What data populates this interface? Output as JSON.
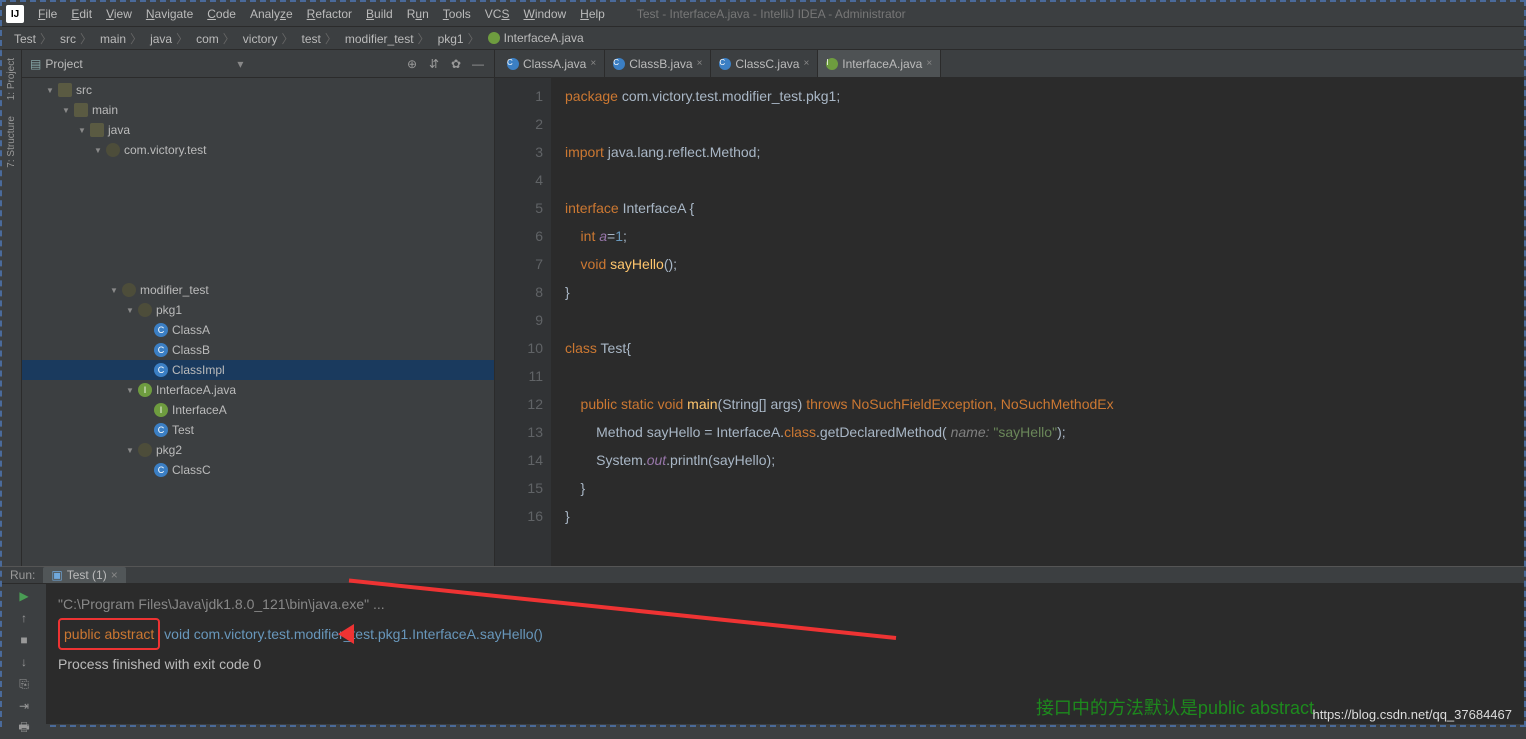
{
  "window_title": "Test - InterfaceA.java - IntelliJ IDEA - Administrator",
  "menus": [
    "File",
    "Edit",
    "View",
    "Navigate",
    "Code",
    "Analyze",
    "Refactor",
    "Build",
    "Run",
    "Tools",
    "VCS",
    "Window",
    "Help"
  ],
  "breadcrumbs": [
    "Test",
    "src",
    "main",
    "java",
    "com",
    "victory",
    "test",
    "modifier_test",
    "pkg1",
    "InterfaceA.java"
  ],
  "project": {
    "title": "Project",
    "nodes": [
      {
        "pad": 24,
        "arr": "▼",
        "ic": "fold",
        "label": "src"
      },
      {
        "pad": 40,
        "arr": "▼",
        "ic": "fold",
        "label": "main"
      },
      {
        "pad": 56,
        "arr": "▼",
        "ic": "fold",
        "label": "java"
      },
      {
        "pad": 72,
        "arr": "▼",
        "ic": "pkg",
        "label": "com.victory.test"
      },
      {
        "pad": 88,
        "arr": "",
        "ic": "",
        "label": "",
        "blur": true
      },
      {
        "pad": 88,
        "arr": "",
        "ic": "",
        "label": "",
        "blur": true
      },
      {
        "pad": 88,
        "arr": "",
        "ic": "",
        "label": "",
        "blur": true
      },
      {
        "pad": 88,
        "arr": "",
        "ic": "",
        "label": "",
        "blur": true
      },
      {
        "pad": 88,
        "arr": "",
        "ic": "",
        "label": "",
        "blur": true
      },
      {
        "pad": 88,
        "arr": "",
        "ic": "",
        "label": "",
        "blur": true
      },
      {
        "pad": 88,
        "arr": "▼",
        "ic": "pkg",
        "label": "modifier_test"
      },
      {
        "pad": 104,
        "arr": "▼",
        "ic": "pkg",
        "label": "pkg1"
      },
      {
        "pad": 120,
        "arr": "",
        "ic": "cls",
        "label": "ClassA"
      },
      {
        "pad": 120,
        "arr": "",
        "ic": "cls",
        "label": "ClassB"
      },
      {
        "pad": 120,
        "arr": "",
        "ic": "cls",
        "label": "ClassImpl",
        "sel": true
      },
      {
        "pad": 104,
        "arr": "▼",
        "ic": "int",
        "label": "InterfaceA.java"
      },
      {
        "pad": 120,
        "arr": "",
        "ic": "int",
        "label": "InterfaceA"
      },
      {
        "pad": 120,
        "arr": "",
        "ic": "cls",
        "label": "Test"
      },
      {
        "pad": 104,
        "arr": "▼",
        "ic": "pkg",
        "label": "pkg2"
      },
      {
        "pad": 120,
        "arr": "",
        "ic": "cls",
        "label": "ClassC"
      },
      {
        "pad": 88,
        "arr": "",
        "ic": "",
        "label": "",
        "blur": true
      },
      {
        "pad": 88,
        "arr": "",
        "ic": "",
        "label": "",
        "blur": true
      }
    ]
  },
  "tabs": [
    {
      "ic": "cls",
      "label": "ClassA.java"
    },
    {
      "ic": "cls",
      "label": "ClassB.java"
    },
    {
      "ic": "cls",
      "label": "ClassC.java"
    },
    {
      "ic": "int",
      "label": "InterfaceA.java",
      "active": true
    }
  ],
  "gutter": [
    {
      "n": "1"
    },
    {
      "n": "2"
    },
    {
      "n": "3"
    },
    {
      "n": "4"
    },
    {
      "n": "5",
      "mark": "ov"
    },
    {
      "n": "6"
    },
    {
      "n": "7",
      "mark": "ov"
    },
    {
      "n": "8"
    },
    {
      "n": "9"
    },
    {
      "n": "10",
      "mark": "play"
    },
    {
      "n": "11"
    },
    {
      "n": "12",
      "mark": "play"
    },
    {
      "n": "13"
    },
    {
      "n": "14"
    },
    {
      "n": "15"
    },
    {
      "n": "16"
    }
  ],
  "code": {
    "l1a": "package ",
    "l1b": "com.victory.test.modifier_test.pkg1;",
    "l3a": "import ",
    "l3b": "java.lang.reflect.Method;",
    "l5a": "interface ",
    "l5b": "InterfaceA ",
    "l5c": "{",
    "l6a": "    int ",
    "l6b": "a",
    "l6c": "=",
    "l6d": "1",
    "l6e": ";",
    "l7a": "    void ",
    "l7b": "sayHello",
    "l7c": "();",
    "l8": "}",
    "l10a": "class ",
    "l10b": "Test",
    "l10c": "{",
    "l12a": "    public static void ",
    "l12b": "main",
    "l12c": "(String[] ",
    "l12d": "args",
    "l12e": ") ",
    "l12f": "throws ",
    "l12g": "NoSuchFieldException, NoSuchMethodEx",
    "l13a": "        Method sayHello = InterfaceA.",
    "l13b": "class",
    "l13c": ".getDeclaredMethod( ",
    "l13d": "name: ",
    "l13e": "\"sayHello\"",
    "l13f": ");",
    "l14a": "        System.",
    "l14b": "out",
    "l14c": ".println(sayHello);",
    "l15": "    }",
    "l16": "}"
  },
  "run": {
    "panel_label": "Run:",
    "tab": "Test (1)",
    "line1": "\"C:\\Program Files\\Java\\jdk1.8.0_121\\bin\\java.exe\" ...",
    "boxed": "public abstract",
    "line2_rest": " void com.victory.test.modifier_test.pkg1.InterfaceA.sayHello()",
    "line3": "Process finished with exit code 0",
    "note": "接口中的方法默认是public abstract"
  },
  "watermark": "https://blog.csdn.net/qq_37684467",
  "sidetabs": [
    "1: Project",
    "7: Structure"
  ]
}
